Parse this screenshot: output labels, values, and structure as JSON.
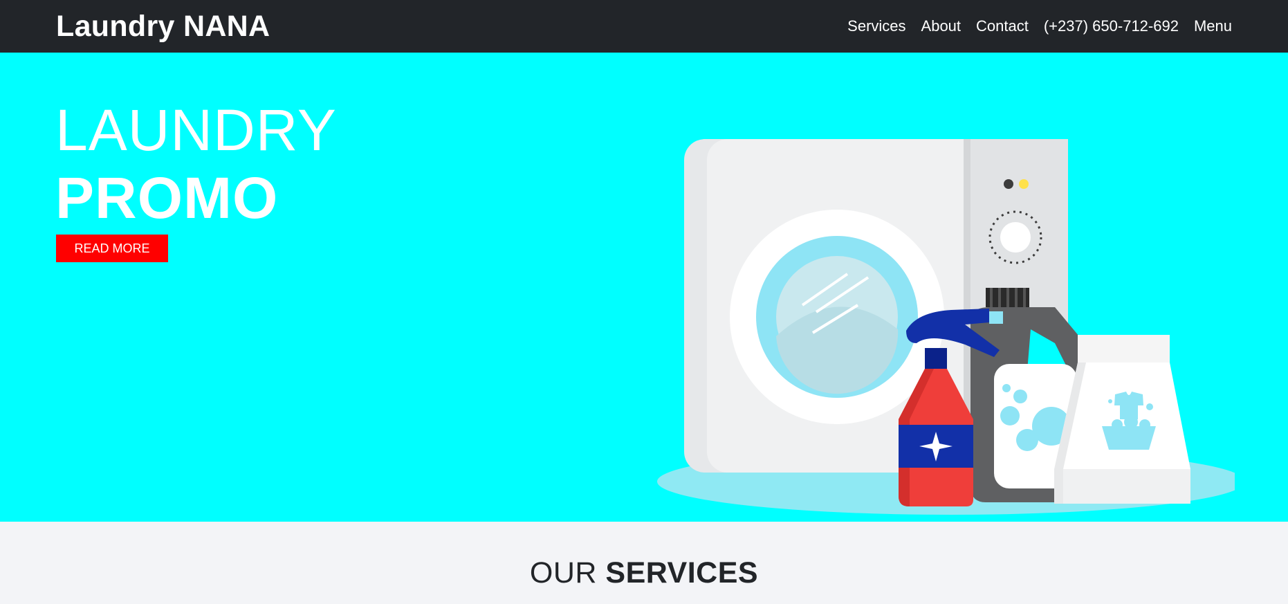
{
  "navbar": {
    "brand": "Laundry NANA",
    "links": [
      {
        "label": "Services"
      },
      {
        "label": "About"
      },
      {
        "label": "Contact"
      },
      {
        "label": "(+237) 650-712-692"
      },
      {
        "label": "Menu"
      }
    ]
  },
  "hero": {
    "title_line1": "LAUNDRY",
    "title_line2": "PROMO",
    "cta_label": "READ MORE",
    "background_color": "#00ffff",
    "illustration": "washing-machine-and-detergents-illustration"
  },
  "services": {
    "title_thin": "OUR",
    "title_bold": "SERVICES"
  },
  "colors": {
    "navbar_bg": "#222529",
    "cta_bg": "#ff0000",
    "section_bg": "#f3f4f7"
  }
}
